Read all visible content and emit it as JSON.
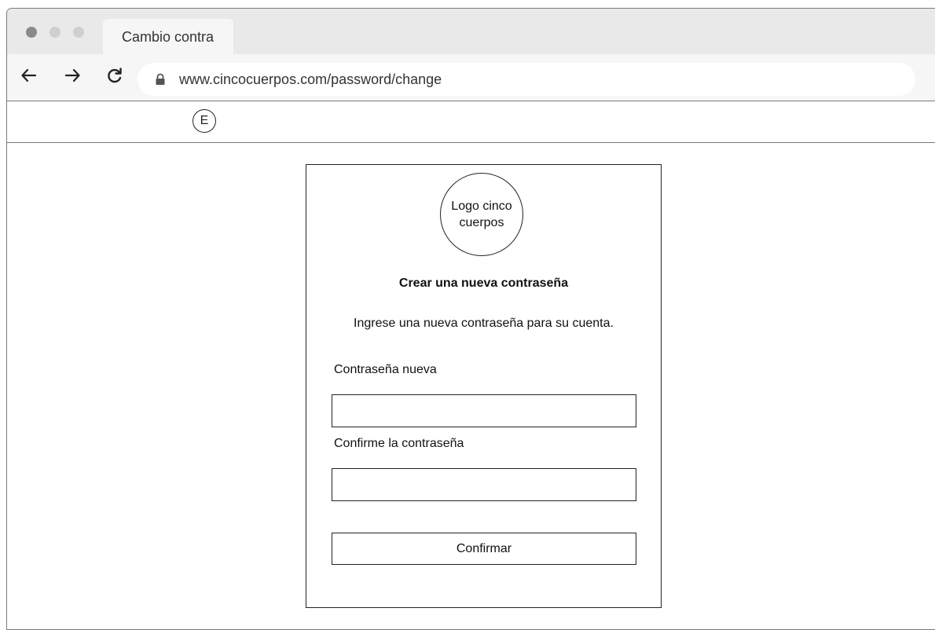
{
  "browser": {
    "tab_title": "Cambio contra",
    "url": "www.cincocuerpos.com/password/change",
    "window_controls": [
      "close",
      "minimize",
      "maximize"
    ],
    "nav_icons": [
      "arrow-left-icon",
      "arrow-right-icon",
      "reload-icon",
      "lock-icon"
    ]
  },
  "toolbar": {
    "extension_label": "E"
  },
  "card": {
    "logo_text": "Logo cinco cuerpos",
    "title": "Crear una nueva contraseña",
    "subtitle": "Ingrese una nueva contraseña para su cuenta.",
    "new_password_label": "Contraseña nueva",
    "new_password_value": "",
    "confirm_password_label": "Confirme la contraseña",
    "confirm_password_value": "",
    "submit_label": "Confirmar"
  },
  "colors": {
    "chrome_bg": "#e9e9e9",
    "toolbar_bg": "#f6f6f6",
    "border": "#222222"
  }
}
